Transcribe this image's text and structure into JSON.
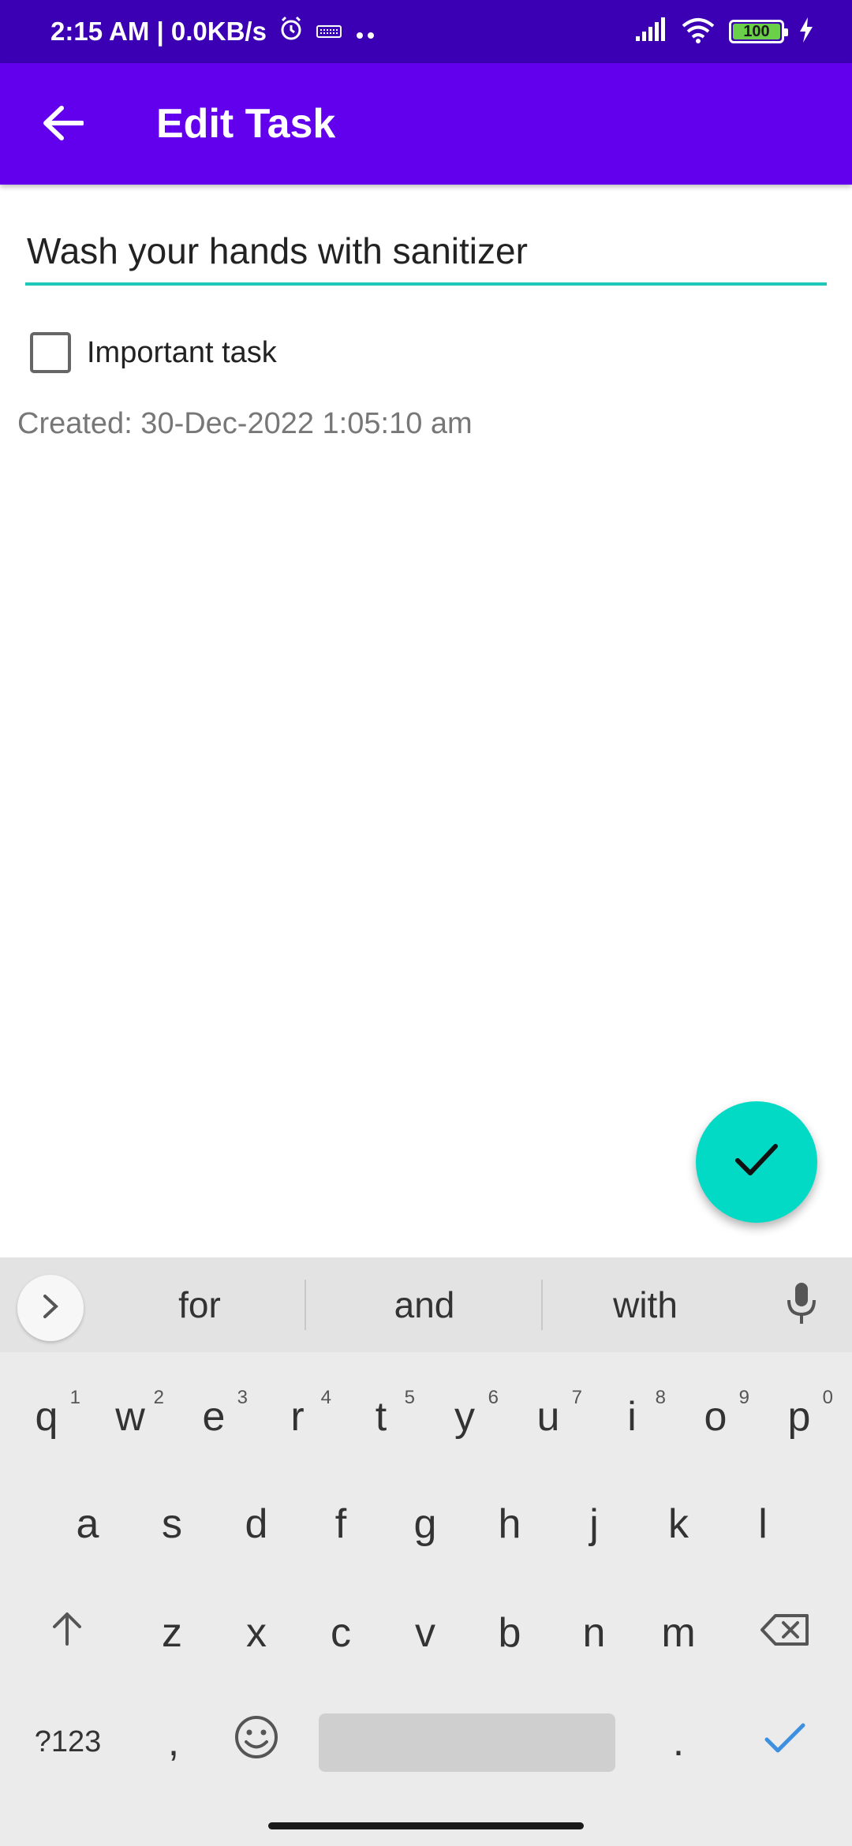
{
  "status_bar": {
    "time_network": "2:15 AM | 0.0KB/s",
    "battery_level": "100"
  },
  "app_bar": {
    "title": "Edit Task"
  },
  "form": {
    "task_name_value": "Wash your hands with sanitizer",
    "important_label": "Important task",
    "important_checked": false,
    "created_text": "Created: 30-Dec-2022 1:05:10 am"
  },
  "keyboard": {
    "suggestions": [
      "for",
      "and",
      "with"
    ],
    "row1": [
      {
        "key": "q",
        "hint": "1"
      },
      {
        "key": "w",
        "hint": "2"
      },
      {
        "key": "e",
        "hint": "3"
      },
      {
        "key": "r",
        "hint": "4"
      },
      {
        "key": "t",
        "hint": "5"
      },
      {
        "key": "y",
        "hint": "6"
      },
      {
        "key": "u",
        "hint": "7"
      },
      {
        "key": "i",
        "hint": "8"
      },
      {
        "key": "o",
        "hint": "9"
      },
      {
        "key": "p",
        "hint": "0"
      }
    ],
    "row2": [
      "a",
      "s",
      "d",
      "f",
      "g",
      "h",
      "j",
      "k",
      "l"
    ],
    "row3": [
      "z",
      "x",
      "c",
      "v",
      "b",
      "n",
      "m"
    ],
    "symbols_label": "?123",
    "comma_label": ",",
    "period_label": "."
  },
  "colors": {
    "status_bar": "#3c00b4",
    "app_bar": "#6200ee",
    "accent": "#03dac6",
    "input_underline": "#1ec8b8",
    "keyboard_bg": "#ebebeb",
    "enter_check": "#3d8fe0"
  },
  "icons": {
    "back": "arrow-left-icon",
    "fab": "check-icon",
    "alarm": "alarm-clock-icon",
    "signal": "signal-icon",
    "wifi": "wifi-icon",
    "charging": "lightning-icon",
    "mic": "microphone-icon",
    "shift": "shift-arrow-icon",
    "backspace": "backspace-icon",
    "emoji": "emoji-icon",
    "enter": "check-enter-icon"
  }
}
